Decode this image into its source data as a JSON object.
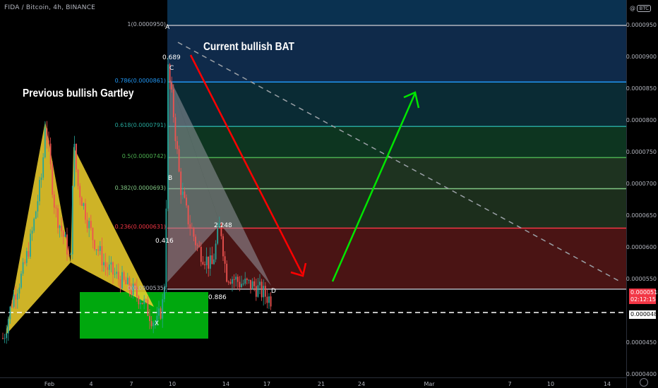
{
  "header": {
    "symbol_text": "FIDA / Bitcoin, 4h, BINANCE"
  },
  "toolbar": {
    "currency_button": "BTC",
    "scale_letter": "@"
  },
  "annotations": {
    "left_title": "Previous bullish Gartley",
    "right_title": "Current bullish BAT"
  },
  "price_axis": {
    "ticks": [
      "0.0000950",
      "0.0000900",
      "0.0000850",
      "0.0000800",
      "0.0000750",
      "0.0000700",
      "0.0000650",
      "0.0000600",
      "0.0000550",
      "0.0000450",
      "0.0000400"
    ],
    "current_price": "0.0000518",
    "countdown": "02:12:15",
    "dashed_line_price": "0.0000484"
  },
  "time_axis": {
    "labels": [
      "Feb",
      "4",
      "7",
      "10",
      "14",
      "17",
      "21",
      "24",
      "Mar",
      "7",
      "10",
      "14"
    ]
  },
  "fib_levels": [
    {
      "label": "1(0.0000950)",
      "price": 9.5e-05,
      "color": "#b2b5be"
    },
    {
      "label": "0.786(0.0000861)",
      "price": 8.61e-05,
      "color": "#2196f3"
    },
    {
      "label": "0.618(0.0000791)",
      "price": 7.91e-05,
      "color": "#26a69a"
    },
    {
      "label": "0.5(0.0000742)",
      "price": 7.42e-05,
      "color": "#4caf50"
    },
    {
      "label": "0.382(0.0000693)",
      "price": 6.93e-05,
      "color": "#81c784"
    },
    {
      "label": "0.236(0.0000631)",
      "price": 6.31e-05,
      "color": "#f23645"
    },
    {
      "label": "0(0.0000535)",
      "price": 5.35e-05,
      "color": "#b2b5be"
    }
  ],
  "pattern_points": {
    "A": "A",
    "C": "C",
    "B": "B",
    "X": "X",
    "D": "D",
    "ratio_c": "0.689",
    "ratio_b": "0.416",
    "ratio_ext": "2.248",
    "ratio_d": "0.886"
  },
  "colors": {
    "up_candle": "#26a69a",
    "down_candle": "#ef5350",
    "gartley_fill": "#f2d22e",
    "bat_fill": "#9598a1",
    "zone_green": "#00a80e",
    "arrow_red": "#ff0000",
    "arrow_green": "#00e600"
  },
  "chart_data": {
    "type": "candlestick",
    "title": "FIDA / Bitcoin, 4h, BINANCE",
    "ylim": [
      3.95e-05,
      9.9e-05
    ],
    "y_unit": "BTC",
    "price_path": [
      [
        4.58e-05,
        "0"
      ],
      [
        4.7e-05,
        "1"
      ],
      [
        5.2e-05,
        "2"
      ],
      [
        5.6e-05,
        "3"
      ],
      [
        6.1e-05,
        "4"
      ],
      [
        6.8e-05,
        "5"
      ],
      [
        7.6e-05,
        "6"
      ],
      [
        8.1e-05,
        "7"
      ],
      [
        7.2e-05,
        "8"
      ],
      [
        6.4e-05,
        "9"
      ],
      [
        6e-05,
        "10"
      ],
      [
        5.7e-05,
        "11"
      ],
      [
        6.8e-05,
        "12"
      ],
      [
        7.7e-05,
        "13"
      ],
      [
        7.4e-05,
        "14"
      ],
      [
        6.6e-05,
        "15"
      ],
      [
        6.2e-05,
        "16"
      ],
      [
        6e-05,
        "17"
      ],
      [
        5.8e-05,
        "18"
      ],
      [
        5.6e-05,
        "19"
      ],
      [
        5.45e-05,
        "20"
      ],
      [
        5.3e-05,
        "21"
      ],
      [
        5.15e-05,
        "22"
      ],
      [
        4.95e-05,
        "23"
      ],
      [
        4.8e-05,
        "24"
      ],
      [
        5.2e-05,
        "25"
      ],
      [
        6e-05,
        "26"
      ],
      [
        8.8e-05,
        "27"
      ],
      [
        8.2e-05,
        "28"
      ],
      [
        7.6e-05,
        "29"
      ],
      [
        7.1e-05,
        "30"
      ],
      [
        6.8e-05,
        "31"
      ],
      [
        6.5e-05,
        "32"
      ],
      [
        6.3e-05,
        "33"
      ],
      [
        6.1e-05,
        "34"
      ],
      [
        5.9e-05,
        "35"
      ],
      [
        5.75e-05,
        "36"
      ],
      [
        6.4e-05,
        "37"
      ],
      [
        5.9e-05,
        "38"
      ],
      [
        5.6e-05,
        "39"
      ],
      [
        5.5e-05,
        "40"
      ],
      [
        5.4e-05,
        "41"
      ],
      [
        5.45e-05,
        "42"
      ],
      [
        5.35e-05,
        "43"
      ],
      [
        5.2e-05,
        "44"
      ]
    ]
  }
}
